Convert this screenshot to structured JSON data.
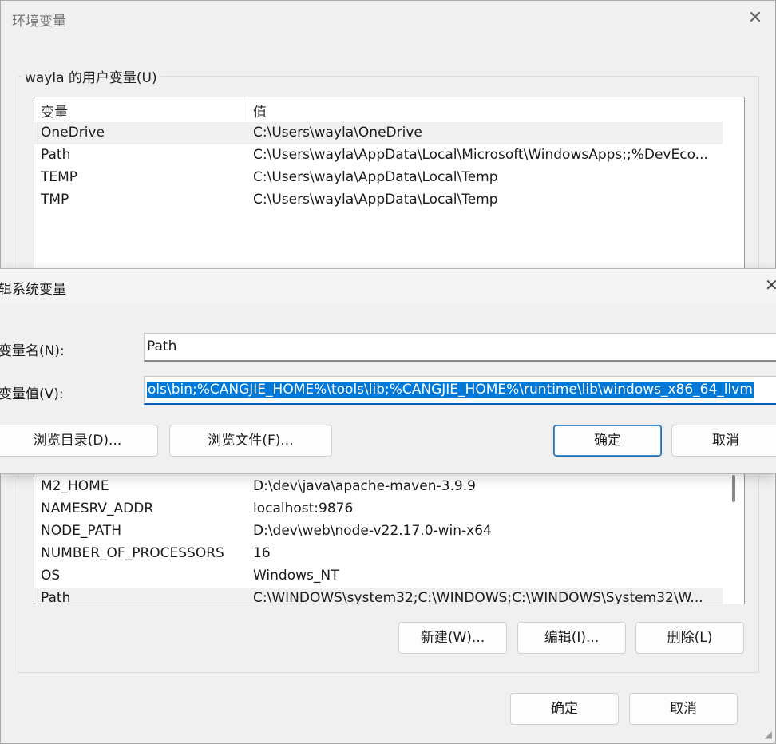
{
  "main_window": {
    "title": "环境变量",
    "close_glyph": "✕"
  },
  "user_vars": {
    "group_label": "wayla 的用户变量(U)",
    "columns": [
      "变量",
      "值"
    ],
    "rows": [
      {
        "name": "OneDrive",
        "value": "C:\\Users\\wayla\\OneDrive",
        "selected": true
      },
      {
        "name": "Path",
        "value": "C:\\Users\\wayla\\AppData\\Local\\Microsoft\\WindowsApps;;%DevEco...",
        "selected": false
      },
      {
        "name": "TEMP",
        "value": "C:\\Users\\wayla\\AppData\\Local\\Temp",
        "selected": false
      },
      {
        "name": "TMP",
        "value": "C:\\Users\\wayla\\AppData\\Local\\Temp",
        "selected": false
      }
    ]
  },
  "system_vars": {
    "rows": [
      {
        "name": "M2_HOME",
        "value": "D:\\dev\\java\\apache-maven-3.9.9",
        "selected": false
      },
      {
        "name": "NAMESRV_ADDR",
        "value": "localhost:9876",
        "selected": false
      },
      {
        "name": "NODE_PATH",
        "value": "D:\\dev\\web\\node-v22.17.0-win-x64",
        "selected": false
      },
      {
        "name": "NUMBER_OF_PROCESSORS",
        "value": "16",
        "selected": false
      },
      {
        "name": "OS",
        "value": "Windows_NT",
        "selected": false
      },
      {
        "name": "Path",
        "value": "C:\\WINDOWS\\system32;C:\\WINDOWS;C:\\WINDOWS\\System32\\W...",
        "selected": true
      }
    ],
    "new_label": "新建(W)...",
    "edit_label": "编辑(I)...",
    "delete_label": "删除(L)"
  },
  "footer": {
    "ok_label": "确定",
    "cancel_label": "取消"
  },
  "edit_dialog": {
    "title": "辑系统变量",
    "close_glyph": "✕",
    "name_label": "变量名(N):",
    "name_value": "Path",
    "value_label": "变量值(V):",
    "value_text": "ols\\bin;%CANGJIE_HOME%\\tools\\lib;%CANGJIE_HOME%\\runtime\\lib\\windows_x86_64_llvm",
    "browse_dir_label": "浏览目录(D)...",
    "browse_file_label": "浏览文件(F)...",
    "ok_label": "确定",
    "cancel_label": "取消"
  }
}
